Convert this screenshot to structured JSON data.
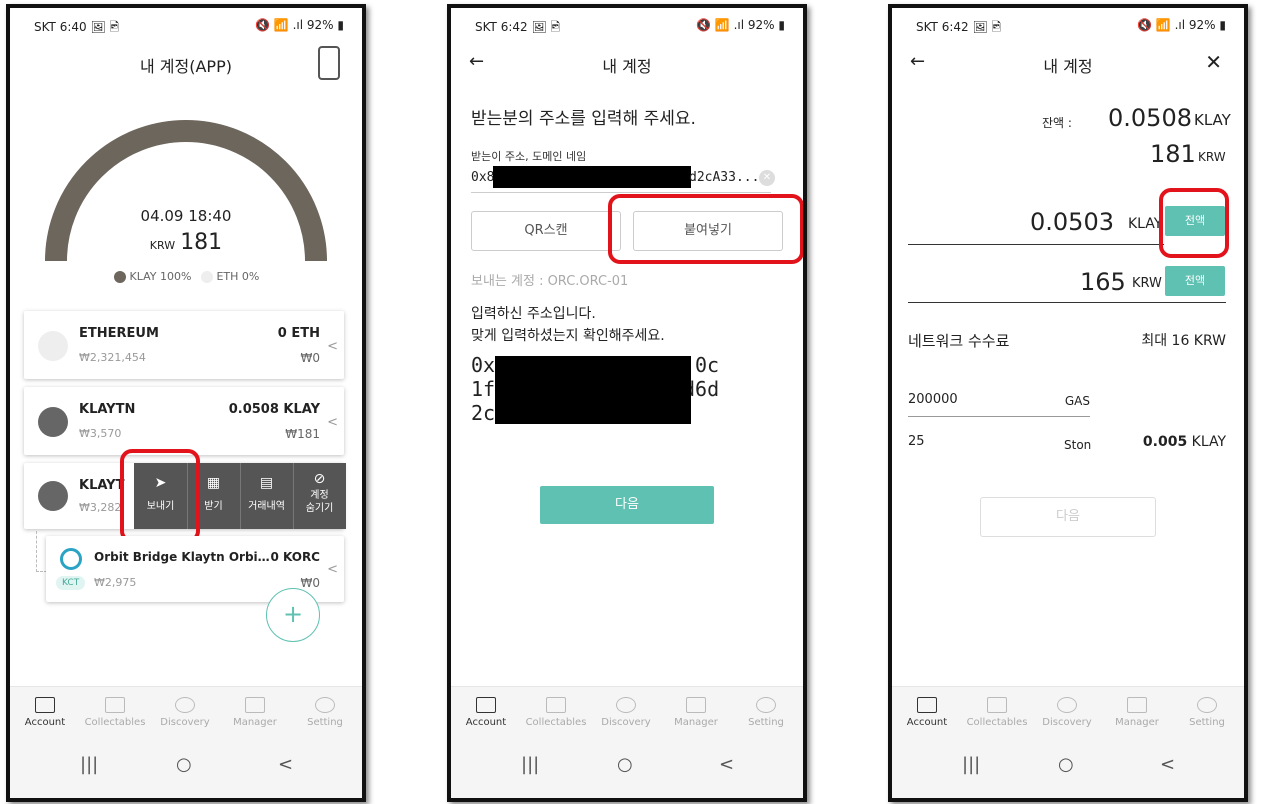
{
  "phone1": {
    "status": {
      "left": "SKT 6:40 🖼 🖻",
      "right": "🔇 📶 .ıl 92% ▮"
    },
    "title": "내 계정(APP)",
    "gauge": {
      "date": "04.09 18:40",
      "currency": "KRW",
      "amount": "181",
      "legend": [
        "KLAY 100%",
        "ETH 0%"
      ],
      "colors": [
        "#6d665c",
        "#eeeeee"
      ]
    },
    "cards": [
      {
        "name": "ETHEREUM",
        "sub": "₩2,321,454",
        "amount": "0 ETH",
        "krw": "₩0",
        "chevron": "<"
      },
      {
        "name": "KLAYTN",
        "sub": "₩3,570",
        "amount": "0.0508 KLAY",
        "krw": "₩181",
        "chevron": "<"
      },
      {
        "name": "KLAYT",
        "sub": "₩3,282"
      }
    ],
    "actions": [
      "보내기",
      "받기",
      "거래내역",
      "계정\n숨기기"
    ],
    "token": {
      "name": "Orbit Bridge Klaytn Orbi…",
      "badge": "KCT",
      "sub": "₩2,975",
      "amount": "0 KORC",
      "krw": "₩0"
    },
    "fab": "+"
  },
  "phone2": {
    "status": {
      "left": "SKT 6:42 🖼 🖻",
      "right": "🔇 📶 .ıl 92% ▮"
    },
    "title": "내 계정",
    "back": "←",
    "heading": "받는분의 주소를 입력해 주세요.",
    "field_label": "받는이 주소, 도메인 네임",
    "address_prefix": "0x8",
    "address_suffix": "d2cA33...",
    "clear": "✕",
    "qr_label": "QR스캔",
    "paste_label": "붙여넣기",
    "sender": "보내는 계정 : ORC.ORC-01",
    "confirm_line1": "입력하신 주소입니다.",
    "confirm_line2": "맞게 입력하셨는지 확인해주세요.",
    "big_addr": [
      "0x",
      "1f",
      "2c"
    ],
    "big_addr_tails": [
      "0c",
      "d6d"
    ],
    "next": "다음"
  },
  "phone3": {
    "status": {
      "left": "SKT 6:42 🖼 🖻",
      "right": "🔇 📶 .ıl 92% ▮"
    },
    "title": "내 계정",
    "back": "←",
    "close": "✕",
    "balance_label": "잔액 :",
    "balance": "0.0508",
    "balance_unit": "KLAY",
    "balance_krw": "181",
    "balance_krw_unit": "KRW",
    "max_label": "전액",
    "input_klay": "0.0503",
    "input_klay_unit": "KLAY",
    "input_krw": "165",
    "input_krw_unit": "KRW",
    "fee_label": "네트워크 수수료",
    "fee_value": "최대 16 KRW",
    "gas_value": "200000",
    "gas_unit": "GAS",
    "ston_value": "25",
    "ston_unit": "Ston",
    "fee_klay": "0.005",
    "fee_klay_unit": "KLAY",
    "next": "다음"
  },
  "tabs": [
    "Account",
    "Collectables",
    "Discovery",
    "Manager",
    "Setting"
  ],
  "nav": [
    "|||",
    "○",
    "<"
  ],
  "colors": {
    "accent": "#5fc1b2",
    "highlight": "#e3131b",
    "gauge": "#6d665c"
  }
}
